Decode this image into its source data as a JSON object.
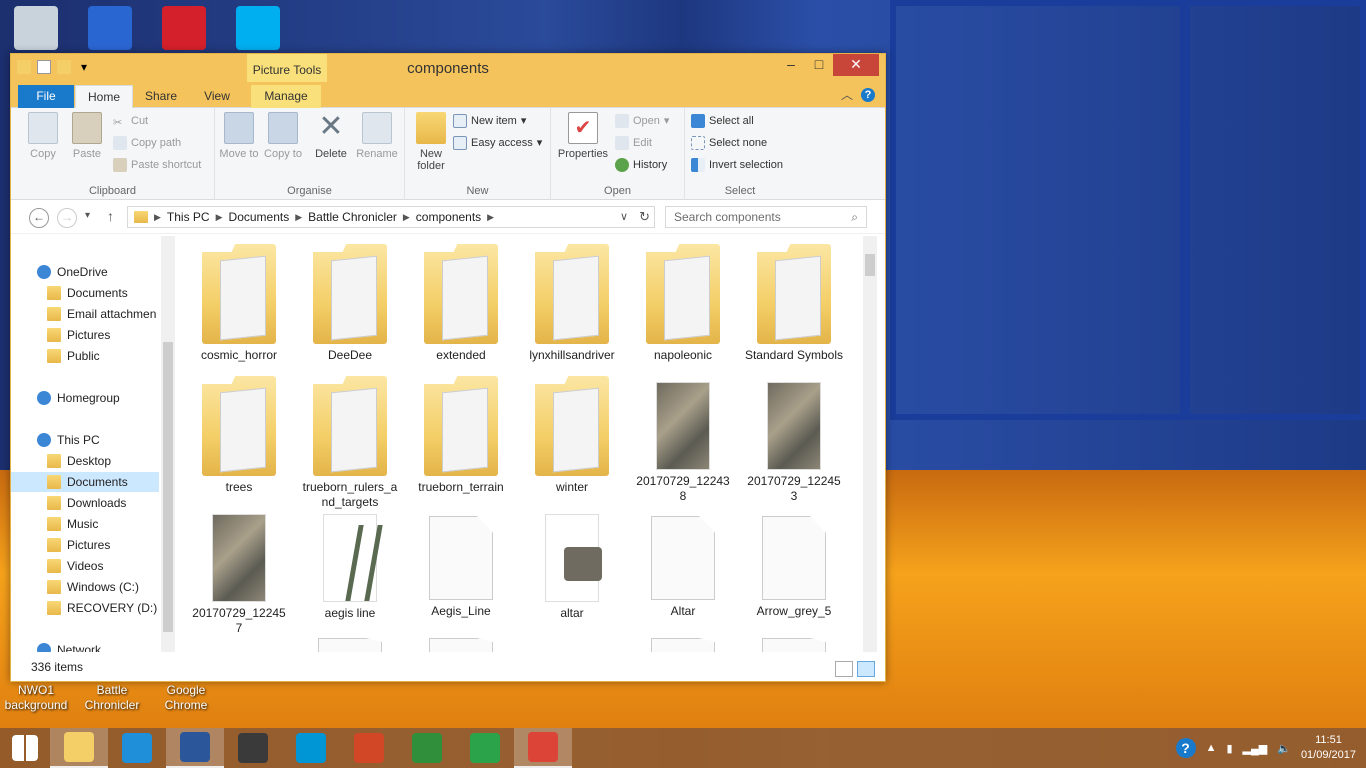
{
  "desktop": {
    "icons_top": [
      {
        "name": "recycle-bin-icon",
        "color": "#c9d3dc"
      },
      {
        "name": "app-shortcut-icon",
        "color": "#2a66d2"
      },
      {
        "name": "adobe-cc-icon",
        "color": "#d4202a"
      },
      {
        "name": "skype-icon",
        "color": "#00aff0"
      }
    ],
    "icons_bottom": [
      {
        "label": "NWO1 background"
      },
      {
        "label": "Battle Chronicler"
      },
      {
        "label": "Google Chrome"
      }
    ]
  },
  "window": {
    "title": "components",
    "context_tab": "Picture Tools",
    "tabs": [
      "File",
      "Home",
      "Share",
      "View",
      "Manage"
    ],
    "ribbon": {
      "clipboard": {
        "label": "Clipboard",
        "copy": "Copy",
        "paste": "Paste",
        "cut": "Cut",
        "copy_path": "Copy path",
        "paste_shortcut": "Paste shortcut"
      },
      "organise": {
        "label": "Organise",
        "move_to": "Move to",
        "copy_to": "Copy to",
        "delete": "Delete",
        "rename": "Rename"
      },
      "new": {
        "label": "New",
        "new_folder": "New folder",
        "new_item": "New item",
        "easy_access": "Easy access"
      },
      "open": {
        "label": "Open",
        "properties": "Properties",
        "open": "Open",
        "edit": "Edit",
        "history": "History"
      },
      "select": {
        "label": "Select",
        "select_all": "Select all",
        "select_none": "Select none",
        "invert": "Invert selection"
      }
    },
    "address": [
      "This PC",
      "Documents",
      "Battle Chronicler",
      "components"
    ],
    "search_placeholder": "Search components",
    "nav": [
      {
        "label": "OneDrive",
        "level": 0
      },
      {
        "label": "Documents",
        "level": 1
      },
      {
        "label": "Email attachmen",
        "level": 1
      },
      {
        "label": "Pictures",
        "level": 1
      },
      {
        "label": "Public",
        "level": 1
      },
      {
        "label": "Homegroup",
        "level": 0
      },
      {
        "label": "This PC",
        "level": 0
      },
      {
        "label": "Desktop",
        "level": 1
      },
      {
        "label": "Documents",
        "level": 1,
        "selected": true
      },
      {
        "label": "Downloads",
        "level": 1
      },
      {
        "label": "Music",
        "level": 1
      },
      {
        "label": "Pictures",
        "level": 1
      },
      {
        "label": "Videos",
        "level": 1
      },
      {
        "label": "Windows (C:)",
        "level": 1
      },
      {
        "label": "RECOVERY (D:)",
        "level": 1
      },
      {
        "label": "Network",
        "level": 0
      }
    ],
    "files": [
      {
        "name": "cosmic_horror",
        "type": "folder"
      },
      {
        "name": "DeeDee",
        "type": "folder"
      },
      {
        "name": "extended",
        "type": "folder"
      },
      {
        "name": "lynxhillsandriver",
        "type": "folder"
      },
      {
        "name": "napoleonic",
        "type": "folder"
      },
      {
        "name": "Standard Symbols",
        "type": "folder"
      },
      {
        "name": "trees",
        "type": "folder"
      },
      {
        "name": "trueborn_rulers_and_targets",
        "type": "folder"
      },
      {
        "name": "trueborn_terrain",
        "type": "folder"
      },
      {
        "name": "winter",
        "type": "folder"
      },
      {
        "name": "20170729_122438",
        "type": "photo"
      },
      {
        "name": "20170729_122453",
        "type": "photo"
      },
      {
        "name": "20170729_122457",
        "type": "photo"
      },
      {
        "name": "aegis line",
        "type": "aegis"
      },
      {
        "name": "Aegis_Line",
        "type": "doc"
      },
      {
        "name": "altar",
        "type": "altar"
      },
      {
        "name": "Altar",
        "type": "doc"
      },
      {
        "name": "Arrow_grey_5",
        "type": "doc"
      }
    ],
    "status": "336 items"
  },
  "taskbar": {
    "apps": [
      {
        "name": "start-icon",
        "color": "#ffffff"
      },
      {
        "name": "file-explorer-icon",
        "color": "#f4cf68",
        "open": true
      },
      {
        "name": "rocket-app-icon",
        "color": "#1e8fd8"
      },
      {
        "name": "word-icon",
        "color": "#2b579a",
        "open": true
      },
      {
        "name": "media-player-icon",
        "color": "#3a3a3a"
      },
      {
        "name": "hp-icon",
        "color": "#0096d6"
      },
      {
        "name": "powerpoint-icon",
        "color": "#d24726"
      },
      {
        "name": "cd-app-icon",
        "color": "#2f8f3a"
      },
      {
        "name": "store-icon",
        "color": "#2aa34a"
      },
      {
        "name": "chrome-icon",
        "color": "#db4437",
        "open": true
      }
    ],
    "time": "11:51",
    "date": "01/09/2017"
  }
}
